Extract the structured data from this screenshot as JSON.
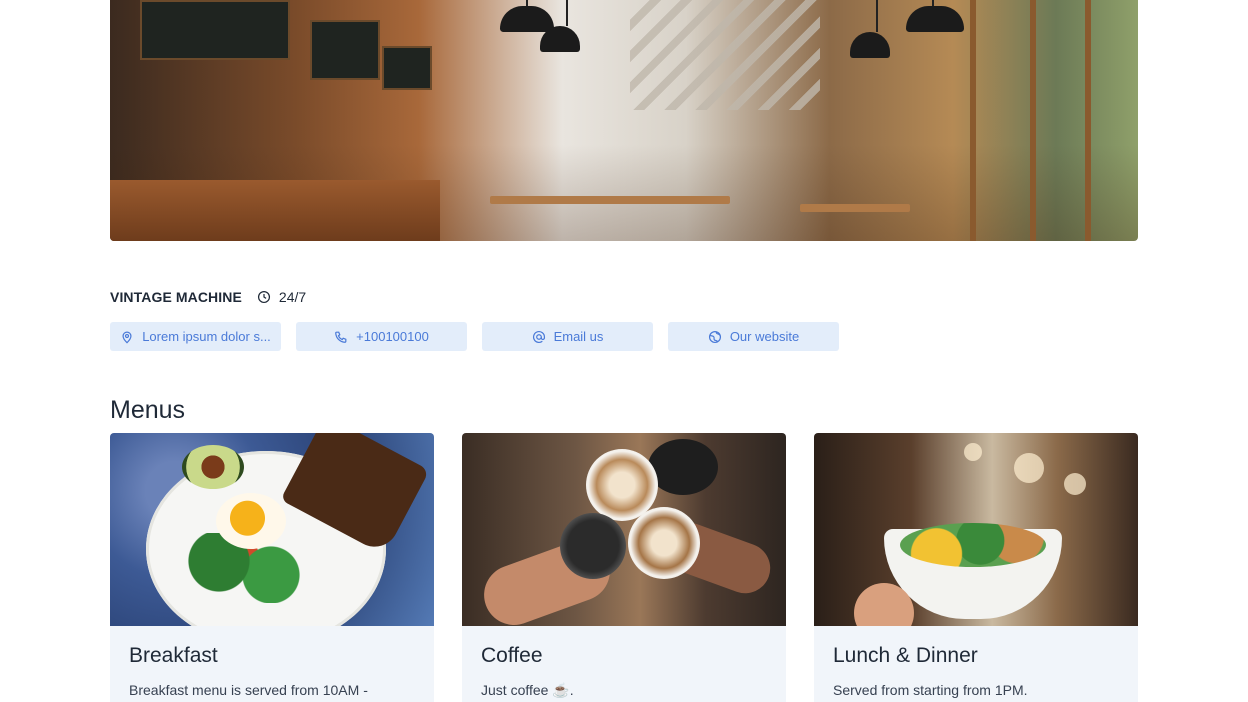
{
  "hero": {
    "image": "cafe-interior-photo"
  },
  "place": {
    "name": "VINTAGE MACHINE",
    "hours_icon": "clock-icon",
    "hours": "24/7"
  },
  "chips": [
    {
      "icon": "location-pin-icon",
      "label": "Lorem ipsum dolor s..."
    },
    {
      "icon": "phone-icon",
      "label": "+100100100"
    },
    {
      "icon": "at-sign-icon",
      "label": "Email us"
    },
    {
      "icon": "globe-icon",
      "label": "Our website"
    }
  ],
  "menus": {
    "title": "Menus",
    "items": [
      {
        "image": "breakfast-plate-photo",
        "title": "Breakfast",
        "text": "Breakfast menu is served from 10AM -"
      },
      {
        "image": "coffee-cups-photo",
        "title": "Coffee",
        "text": "Just coffee ☕."
      },
      {
        "image": "lunch-bowl-photo",
        "title": "Lunch & Dinner",
        "text": "Served from starting from 1PM."
      }
    ]
  },
  "colors": {
    "chip_bg": "#e3edfa",
    "chip_text": "#4a7ad8",
    "card_bg": "#f1f5fa",
    "text": "#1f2937"
  }
}
